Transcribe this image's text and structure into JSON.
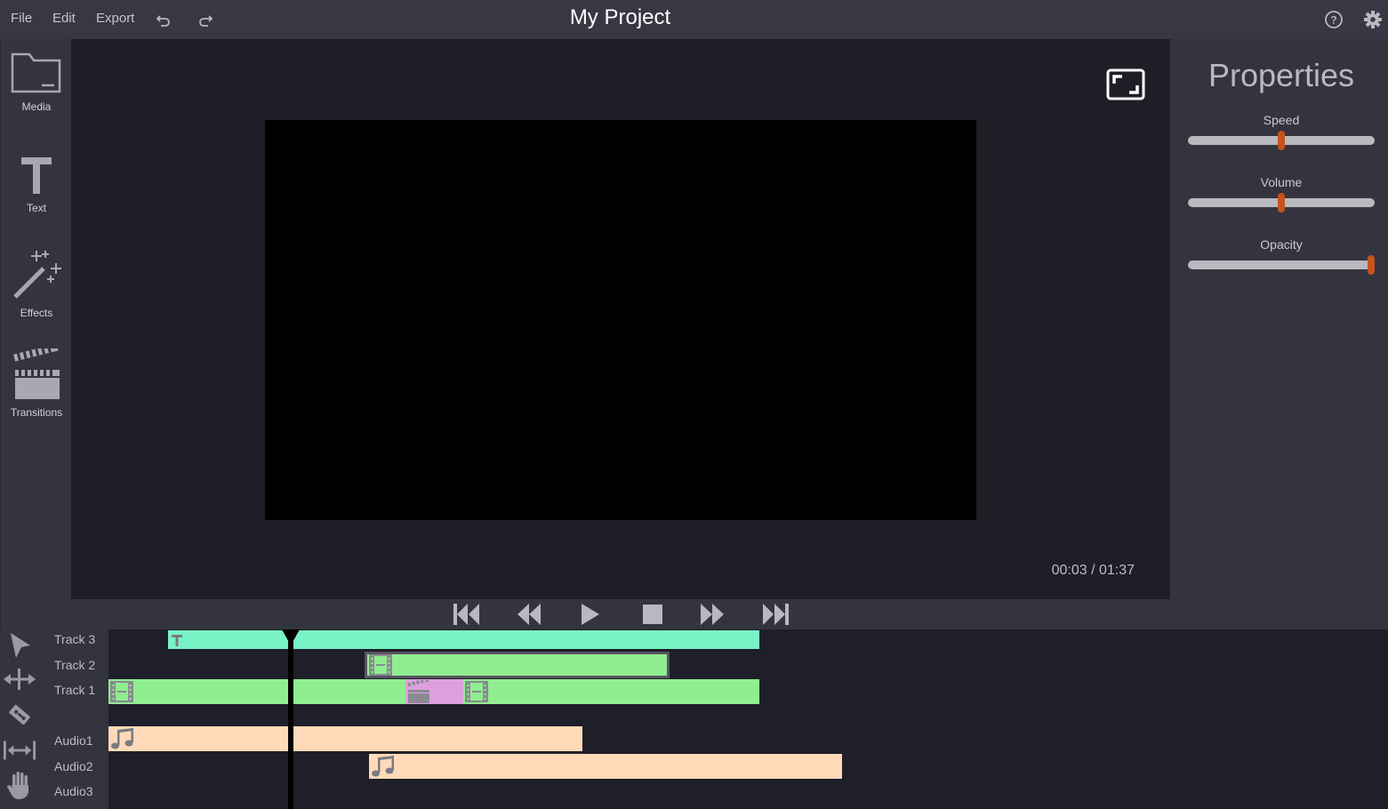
{
  "menu": {
    "file": "File",
    "edit": "Edit",
    "export": "Export"
  },
  "toolbar_icons": [
    "undo-icon",
    "redo-icon",
    "help-icon",
    "settings-icon"
  ],
  "project_title": "My Project",
  "sidebar": {
    "items": [
      {
        "label": "Media",
        "icon": "folder-icon"
      },
      {
        "label": "Text",
        "icon": "text-icon"
      },
      {
        "label": "Effects",
        "icon": "magic-wand-icon"
      },
      {
        "label": "Transitions",
        "icon": "clapperboard-icon"
      }
    ]
  },
  "preview": {
    "timecode": "00:03 / 01:37",
    "fullscreen_icon": "fullscreen-icon"
  },
  "transport": [
    "skip-to-start-icon",
    "rewind-icon",
    "play-icon",
    "stop-icon",
    "fast-forward-icon",
    "skip-to-end-icon"
  ],
  "properties": {
    "title": "Properties",
    "sliders": [
      {
        "label": "Speed",
        "value": 0.5
      },
      {
        "label": "Volume",
        "value": 0.5
      },
      {
        "label": "Opacity",
        "value": 1.0
      }
    ],
    "thumb_color": "#c5531b"
  },
  "timeline": {
    "tools": [
      "pointer-icon",
      "move-icon",
      "razor-icon",
      "stretch-icon",
      "hand-icon"
    ],
    "tracks": [
      "Track 3",
      "Track 2",
      "Track 1",
      "Audio1",
      "Audio2",
      "Audio3"
    ],
    "clip_colors": {
      "text": "#79f2c6",
      "video": "#90ee90",
      "audio": "#ffdab9",
      "transition": "#dda0dd"
    }
  }
}
